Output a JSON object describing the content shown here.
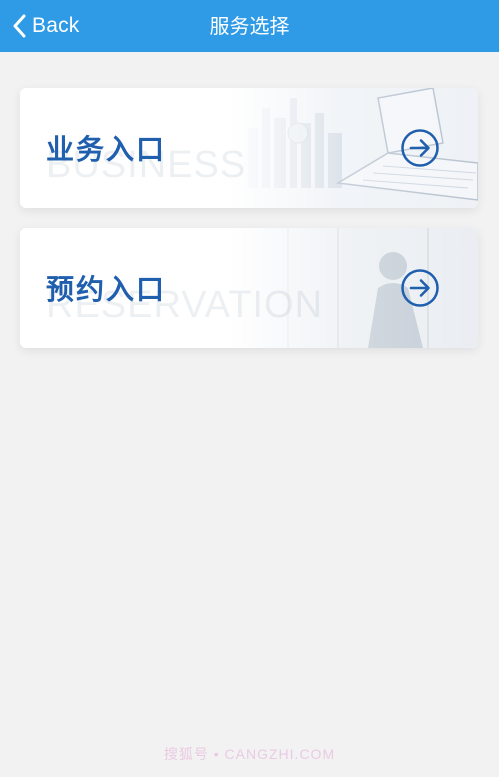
{
  "nav": {
    "back_label": "Back",
    "title": "服务选择"
  },
  "cards": [
    {
      "title": "业务入口",
      "watermark": "BUSINESS",
      "icon": "arrow-right-circle-icon"
    },
    {
      "title": "预约入口",
      "watermark": "RESERVATION",
      "icon": "arrow-right-circle-icon"
    }
  ],
  "footer": {
    "watermark": "搜狐号 • CANGZHI.COM"
  },
  "colors": {
    "nav_bg": "#2f9be6",
    "accent": "#1f5fae",
    "page_bg": "#f2f2f2"
  }
}
